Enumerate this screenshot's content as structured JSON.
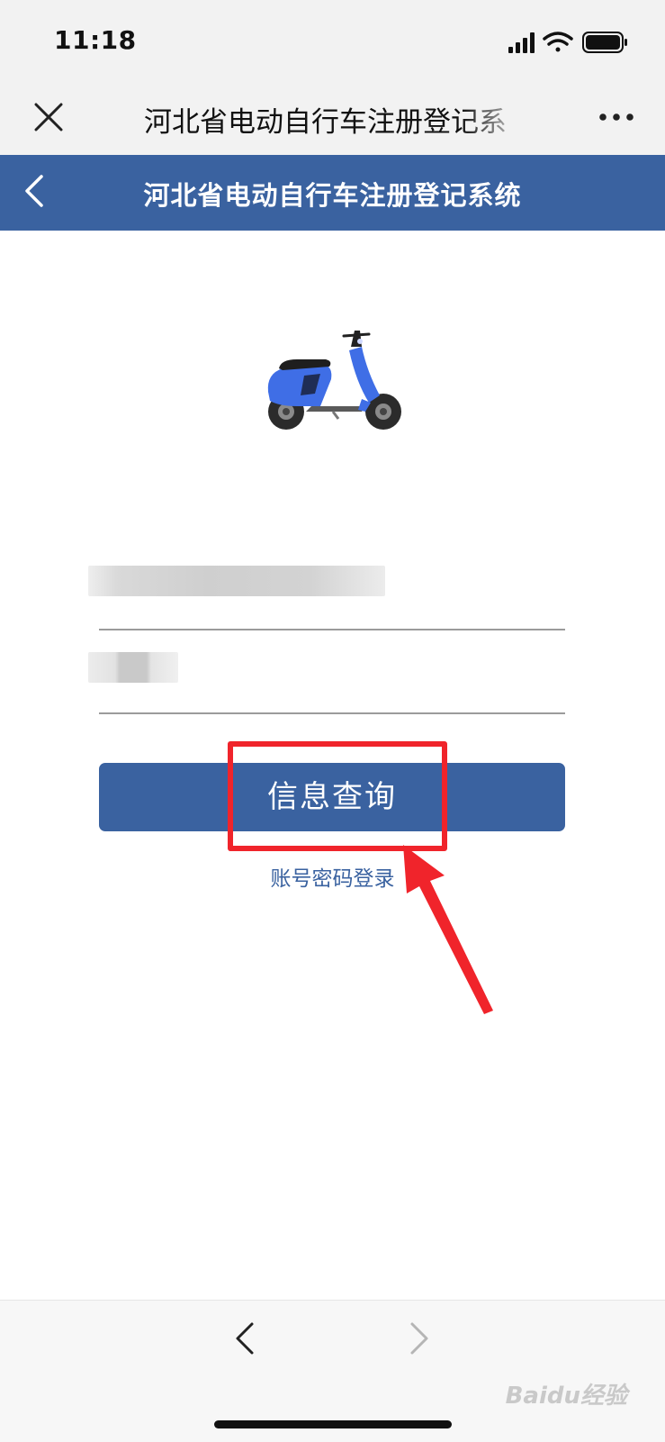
{
  "status_bar": {
    "time": "11:18"
  },
  "wechat_bar": {
    "title": "河北省电动自行车注册登记系"
  },
  "app_header": {
    "title": "河北省电动自行车注册登记系统"
  },
  "form": {
    "query_button_label": "信息查询",
    "login_link_label": "账号密码登录"
  },
  "footer": {
    "watermark": "Baidu经验"
  },
  "colors": {
    "brand": "#3a62a0",
    "annotation": "#f0242b"
  },
  "icons": [
    "close-icon",
    "more-icon",
    "back-icon",
    "scooter-logo",
    "nav-back-icon",
    "nav-forward-icon"
  ]
}
